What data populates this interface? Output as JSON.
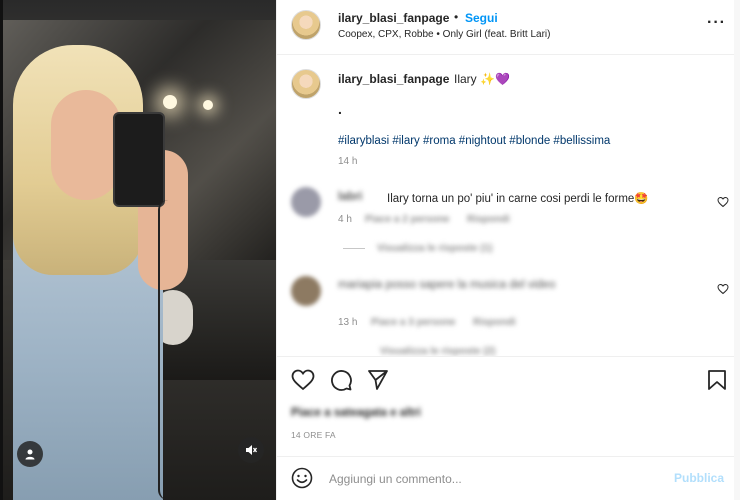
{
  "post": {
    "username": "ilary_blasi_fanpage",
    "separator": "•",
    "follow_label": "Segui",
    "audio_track": "Coopex, CPX, Robbe • Only Girl (feat. Britt Lari)",
    "more_icon": "more-options-icon"
  },
  "caption": {
    "username": "ilary_blasi_fanpage",
    "text": "Ilary ✨💜",
    "dot": ".",
    "hashtags": "#ilaryblasi #ilary #roma #nightout #blonde #bellissima",
    "time": "14 h"
  },
  "comments": [
    {
      "username": "labri",
      "text": "Ilary torna un po' piu' in carne cosi perdi le forme🤩",
      "time": "4 h",
      "likes": "Piace a 2 persone",
      "reply": "Rispondi",
      "view_replies": "Visualizza le risposte (1)"
    },
    {
      "username": "mariapia",
      "text": "posso sapere la musica del video ",
      "time": "13 h",
      "likes": "Piace a 3 persone",
      "reply": "Rispondi",
      "view_replies": "Visualizza le risposte (2)"
    }
  ],
  "actions": {
    "likes_text": "Piace a sateagata e altri",
    "time_ago": "14 ORE FA"
  },
  "add_comment": {
    "placeholder": "Aggiungi un commento...",
    "publish_label": "Pubblica"
  },
  "colors": {
    "accent": "#0095f6",
    "publish_disabled": "#b2dffc",
    "hashtag": "#00376b",
    "muted": "#8e8e8e"
  }
}
